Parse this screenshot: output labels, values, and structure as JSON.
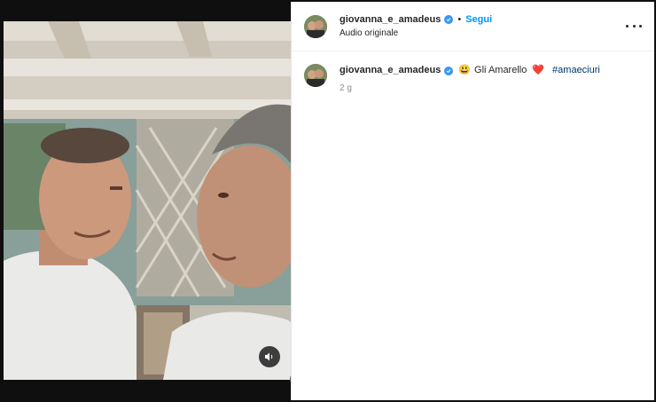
{
  "post": {
    "author": {
      "username": "giovanna_e_amadeus",
      "verified": true,
      "avatar": "avatar"
    },
    "header": {
      "separator": "•",
      "follow_label": "Segui",
      "audio_label": "Audio originale",
      "more_icon": "more-horizontal-icon"
    },
    "caption": {
      "username": "giovanna_e_amadeus",
      "emoji": "😃",
      "text": "Gli Amarello",
      "heart": "❤️",
      "hashtag": "#amaeciuri"
    },
    "timestamp": "2 g"
  },
  "media": {
    "type": "video",
    "audio_icon": "speaker-icon"
  },
  "colors": {
    "follow": "#0095f6",
    "verified": "#3897f0",
    "hashtag": "#00376b",
    "text": "#262626",
    "muted": "#8e8e8e"
  }
}
